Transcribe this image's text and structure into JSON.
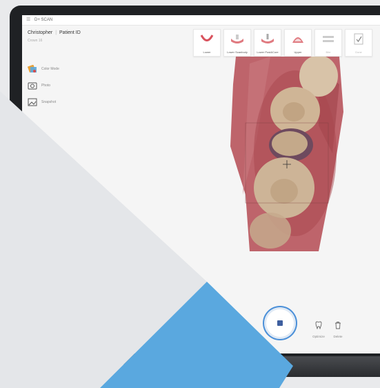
{
  "app": {
    "name": "D+ SCAN"
  },
  "patient": {
    "name": "Christopher",
    "id_label": "Patient ID",
    "subtitle": "Crown 16"
  },
  "tools": [
    {
      "label": "Color Mode",
      "icon": "color-mode-icon"
    },
    {
      "label": "Photo",
      "icon": "camera-icon"
    },
    {
      "label": "Snapshot",
      "icon": "snapshot-icon"
    }
  ],
  "scan_types": [
    {
      "label": "Lower",
      "icon": "lower-arch-icon",
      "state": "active"
    },
    {
      "label": "Lower Scanbody",
      "icon": "lower-scanbody-icon",
      "state": "normal"
    },
    {
      "label": "Lower Post&Core",
      "icon": "lower-post-core-icon",
      "state": "normal"
    },
    {
      "label": "Upper",
      "icon": "upper-arch-icon",
      "state": "normal"
    },
    {
      "label": "Bite",
      "icon": "bite-icon",
      "state": "disabled"
    },
    {
      "label": "Done",
      "icon": "done-icon",
      "state": "disabled"
    }
  ],
  "actions": {
    "record": "record-stop-icon",
    "optimize": "Optimize",
    "delete": "Delete"
  },
  "colors": {
    "accent": "#4a8fd8",
    "decor_blue": "#5aa8df",
    "decor_grey": "#e4e6e9",
    "gum": "#b8545c"
  }
}
